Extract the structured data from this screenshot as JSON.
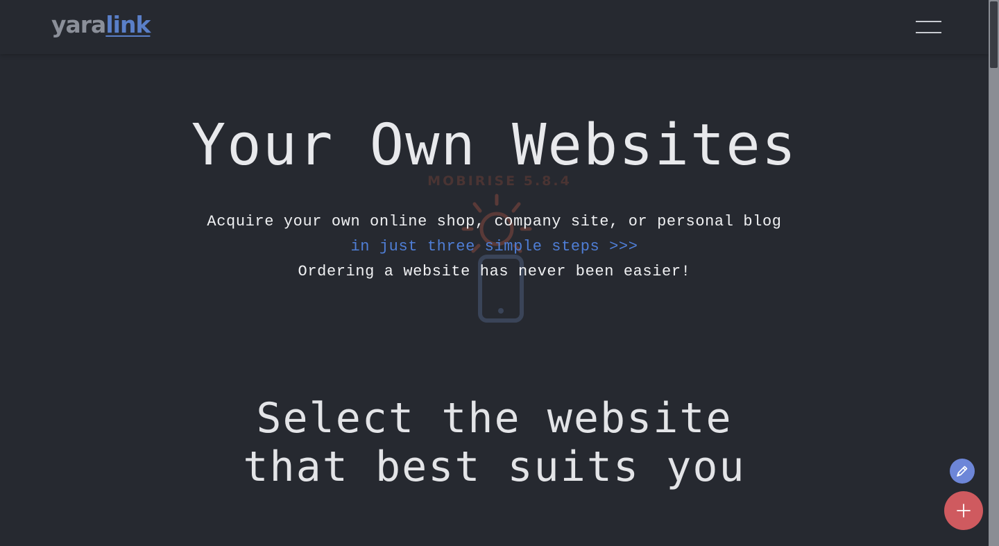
{
  "header": {
    "logo_part1": "yara",
    "logo_part2": "link",
    "menu_icon": "hamburger-menu-icon"
  },
  "watermark": {
    "text": "MOBIRISE 5.8.4",
    "icon": "mobile-sun-icon"
  },
  "hero": {
    "title": "Your Own Websites",
    "line1": "Acquire your own online shop, company site, or personal blog",
    "link_text": "in just three simple steps >>>",
    "line3": "Ordering a website has never been easier!"
  },
  "section": {
    "title_line1": "Select the website",
    "title_line2": "that best suits you"
  },
  "fab": {
    "edit_icon": "pencil-icon",
    "add_icon": "plus-icon"
  },
  "colors": {
    "background": "#262930",
    "accent_blue": "#4f7ed6",
    "fab_red": "#cf5a5f",
    "fab_blue": "#6d86d8"
  }
}
